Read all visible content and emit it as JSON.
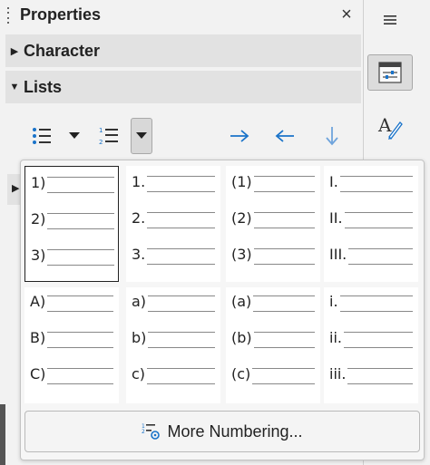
{
  "panel": {
    "title": "Properties",
    "close_glyph": "×",
    "sections": [
      {
        "label": "Character",
        "expanded": false
      },
      {
        "label": "Lists",
        "expanded": true
      }
    ]
  },
  "toolbar": {
    "items": [
      {
        "name": "bullet-list-icon"
      },
      {
        "name": "bullet-list-dropdown-icon"
      },
      {
        "name": "numbered-list-icon"
      },
      {
        "name": "numbered-list-dropdown-icon",
        "active": true
      },
      {
        "name": "indent-arrow-right-icon"
      },
      {
        "name": "outdent-arrow-left-icon"
      },
      {
        "name": "arrow-down-icon"
      }
    ]
  },
  "numbering": {
    "rows": [
      [
        {
          "marks": [
            "1)",
            "2)",
            "3)"
          ],
          "selected": true
        },
        {
          "marks": [
            "1.",
            "2.",
            "3."
          ]
        },
        {
          "marks": [
            "(1)",
            "(2)",
            "(3)"
          ]
        },
        {
          "marks": [
            "I.",
            "II.",
            "III."
          ]
        }
      ],
      [
        {
          "marks": [
            "A)",
            "B)",
            "C)"
          ]
        },
        {
          "marks": [
            "a)",
            "b)",
            "c)"
          ]
        },
        {
          "marks": [
            "(a)",
            "(b)",
            "(c)"
          ]
        },
        {
          "marks": [
            "i.",
            "ii.",
            "iii."
          ]
        }
      ]
    ],
    "more_button": "More Numbering..."
  },
  "sidebar": {
    "items": [
      {
        "name": "menu-icon"
      },
      {
        "name": "properties-icon",
        "active": true
      },
      {
        "name": "styles-icon"
      }
    ]
  },
  "colors": {
    "accent": "#1a73c9",
    "section_bg": "#e2e2e2"
  }
}
